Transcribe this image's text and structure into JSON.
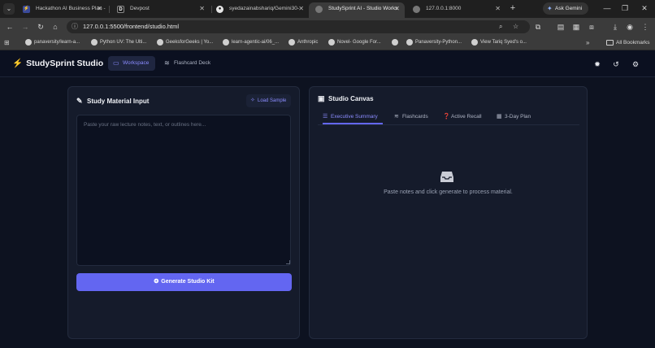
{
  "browser": {
    "tabs": [
      {
        "title": "Hackathon AI Business Plan -",
        "icon": "bolt-tab-icon",
        "active": false
      },
      {
        "title": "Devpost",
        "icon": "devpost-icon",
        "active": false
      },
      {
        "title": "syedazainabshariq/Gemini30-",
        "icon": "github-icon",
        "active": false
      },
      {
        "title": "StudySprint AI - Studio Works",
        "icon": "globe-icon",
        "active": true
      },
      {
        "title": "127.0.0.1:8000",
        "icon": "globe-icon",
        "active": false
      }
    ],
    "ask_gemini": "Ask Gemini",
    "url": "127.0.0.1:5500/frontend/studio.html",
    "bookmarks": [
      "panaversity/learn-a...",
      "Python UV: The Ulti...",
      "GeeksforGeeks | Yo...",
      "learn-agentic-ai/06_...",
      "Anthropic",
      "Novel- Google For...",
      "",
      "Panaversity-Python...",
      "View Tariq Syed's o..."
    ],
    "more_bookmarks": "»",
    "all_bookmarks": "All Bookmarks"
  },
  "app": {
    "brand": "StudySprint",
    "brand_suffix": "Studio",
    "nav": [
      {
        "label": "Workspace",
        "active": true
      },
      {
        "label": "Flashcard Deck",
        "active": false
      }
    ],
    "accent": "#6366f1"
  },
  "input_panel": {
    "title": "Study Material Input",
    "load_sample": "Load Sample",
    "placeholder": "Paste your raw lecture notes, text, or outlines here...",
    "generate_label": "Generate Studio Kit"
  },
  "canvas_panel": {
    "title": "Studio Canvas",
    "tabs": [
      {
        "label": "Executive Summary",
        "icon": "list-icon",
        "active": true
      },
      {
        "label": "Flashcards",
        "icon": "layers-icon",
        "active": false
      },
      {
        "label": "Active Recall",
        "icon": "question-icon",
        "active": false
      },
      {
        "label": "3-Day Plan",
        "icon": "calendar-icon",
        "active": false
      }
    ],
    "empty_message": "Paste notes and click generate to process material."
  }
}
